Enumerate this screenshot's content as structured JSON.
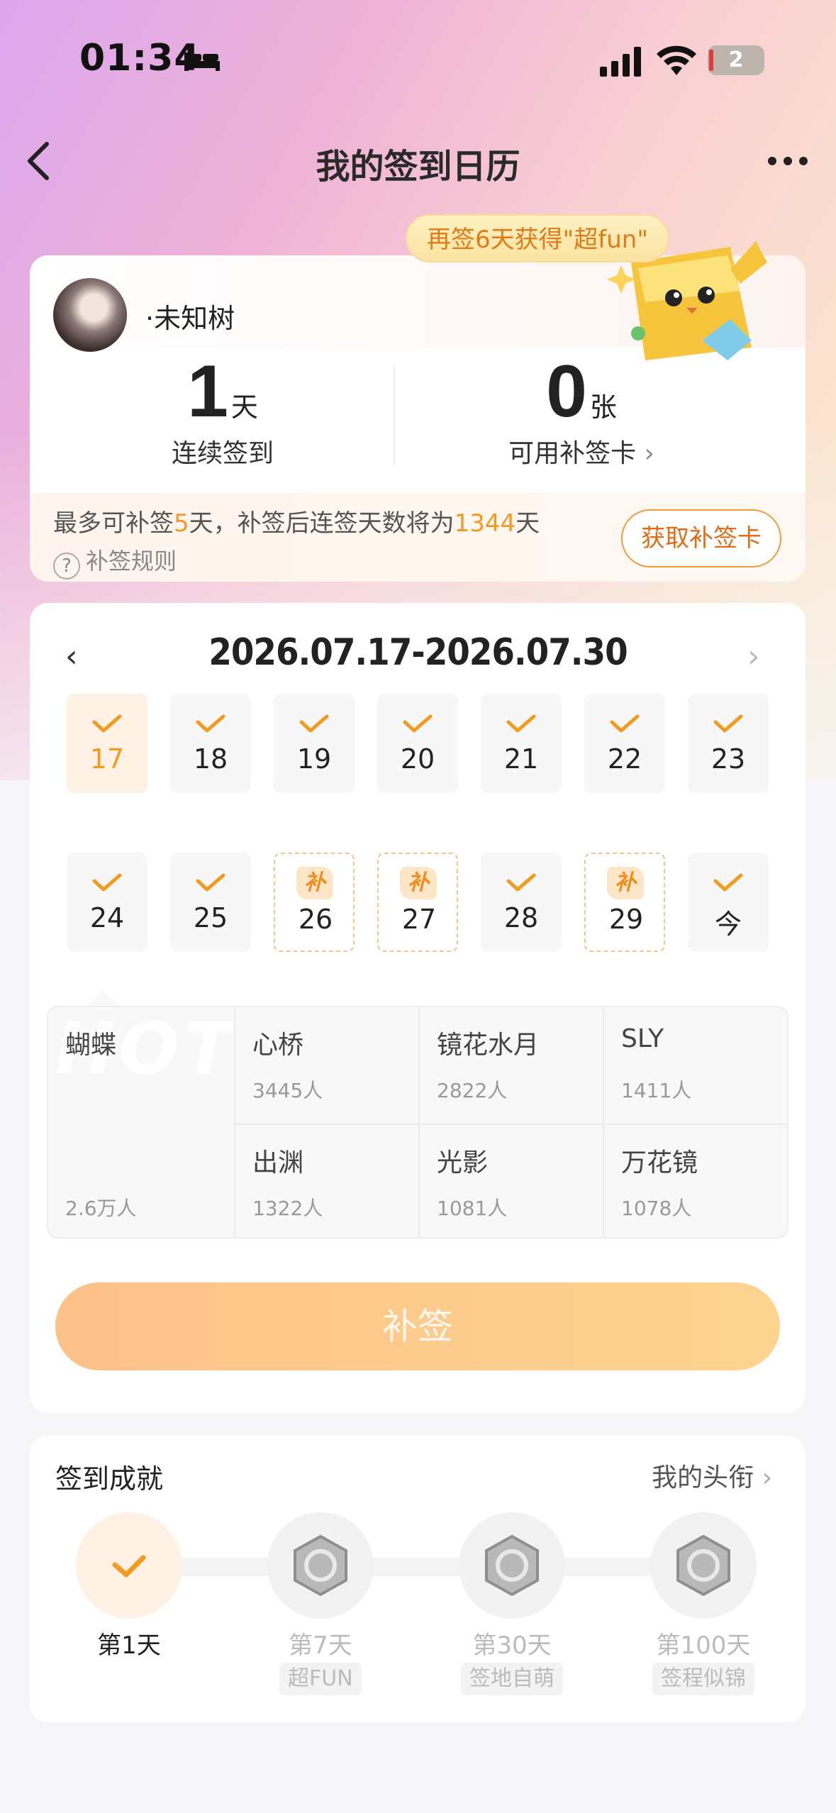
{
  "status": {
    "time": "01:34",
    "battery": "2"
  },
  "nav": {
    "title": "我的签到日历"
  },
  "summary": {
    "tip": "再签6天获得\"超fun\"",
    "user_name": "·未知树",
    "streak_value": "1",
    "streak_unit": "天",
    "streak_label": "连续签到",
    "cards_value": "0",
    "cards_unit": "张",
    "cards_label": "可用补签卡",
    "note_prefix": "最多可补签",
    "note_days": "5",
    "note_mid": "天，补签后连签天数将为",
    "note_total": "1344",
    "note_suffix": "天",
    "rules_label": "补签规则",
    "get_card_button": "获取补签卡"
  },
  "calendar": {
    "range": "2026.07.17-2026.07.30",
    "days": [
      {
        "label": "17",
        "state": "selected"
      },
      {
        "label": "18",
        "state": "checked"
      },
      {
        "label": "19",
        "state": "checked"
      },
      {
        "label": "20",
        "state": "checked"
      },
      {
        "label": "21",
        "state": "checked"
      },
      {
        "label": "22",
        "state": "checked"
      },
      {
        "label": "23",
        "state": "checked"
      },
      {
        "label": "24",
        "state": "checked"
      },
      {
        "label": "25",
        "state": "checked"
      },
      {
        "label": "26",
        "state": "makeup",
        "tag": "补"
      },
      {
        "label": "27",
        "state": "makeup",
        "tag": "补"
      },
      {
        "label": "28",
        "state": "checked"
      },
      {
        "label": "29",
        "state": "makeup",
        "tag": "补"
      },
      {
        "label": "今",
        "state": "checked"
      }
    ]
  },
  "hot": {
    "watermark": "HOT",
    "featured": {
      "name": "蝴蝶",
      "count": "2.6万人"
    },
    "items": [
      {
        "name": "心桥",
        "count": "3445人"
      },
      {
        "name": "镜花水月",
        "count": "2822人"
      },
      {
        "name": "SLY",
        "count": "1411人"
      },
      {
        "name": "出渊",
        "count": "1322人"
      },
      {
        "name": "光影",
        "count": "1081人"
      },
      {
        "name": "万花镜",
        "count": "1078人"
      }
    ]
  },
  "makeup_button": "补签",
  "achievements": {
    "title": "签到成就",
    "link": "我的头衔",
    "items": [
      {
        "label": "第1天",
        "sub": "",
        "icon": "check-icon"
      },
      {
        "label": "第7天",
        "sub": "超FUN",
        "icon": "rock-hand-badge-icon"
      },
      {
        "label": "第30天",
        "sub": "签地自萌",
        "icon": "30-days-badge-icon"
      },
      {
        "label": "第100天",
        "sub": "签程似锦",
        "icon": "100-days-badge-icon"
      }
    ]
  },
  "colors": {
    "accent": "#f39a21",
    "button_start": "#fdc18a",
    "button_end": "#fdd58f"
  }
}
